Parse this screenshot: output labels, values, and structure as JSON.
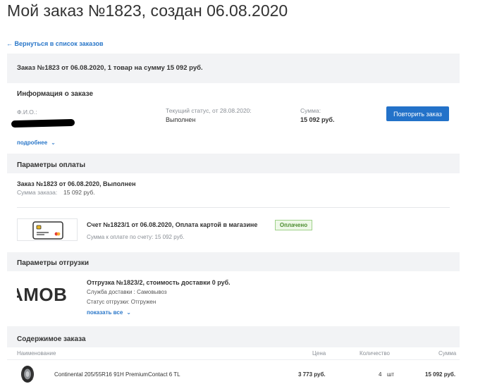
{
  "page_title": "Мой заказ №1823, создан 06.08.2020",
  "back_link": "← Вернуться в список заказов",
  "summary": "Заказ №1823 от 06.08.2020, 1 товар на сумму 15 092 руб.",
  "info": {
    "title": "Информация о заказе",
    "fio_label": "Ф.И.О.:",
    "status_label": "Текущий статус, от 28.08.2020:",
    "status_value": "Выполнен",
    "sum_label": "Сумма:",
    "sum_value": "15 092 руб.",
    "more_link": "подробнее",
    "repeat_button": "Повторить заказ"
  },
  "payment": {
    "title": "Параметры оплаты",
    "order_line": "Заказ №1823 от 06.08.2020, Выполнен",
    "order_sum_label": "Сумма заказа:",
    "order_sum_value": "15 092 руб.",
    "invoice_title": "Счет №1823/1 от 06.08.2020, Оплата картой в магазине",
    "paid_badge": "Оплачено",
    "invoice_sum": "Сумма к оплате по счету: 15 092 руб."
  },
  "shipment": {
    "title": "Параметры отгрузки",
    "logo_text": "АМОВ",
    "shipment_title": "Отгрузка №1823/2, стоимость доставки 0 руб.",
    "service": "Служба доставки : Самовывоз",
    "status": "Статус отгрузки: Отгружен",
    "show_all": "показать все"
  },
  "contents": {
    "title": "Содержимое заказа",
    "columns": [
      "Наименование",
      "Цена",
      "Количество",
      "Сумма"
    ],
    "rows": [
      {
        "name": "Continental 205/55R16 91H PremiumContact 6 TL",
        "price": "3 773 руб.",
        "qty": "4",
        "unit": "шт",
        "sum": "15 092 руб."
      }
    ]
  },
  "colors": {
    "accent": "#2372c9",
    "link": "#2a77c9",
    "panel_bg": "#f2f3f5",
    "paid_green": "#4b8c2f"
  }
}
